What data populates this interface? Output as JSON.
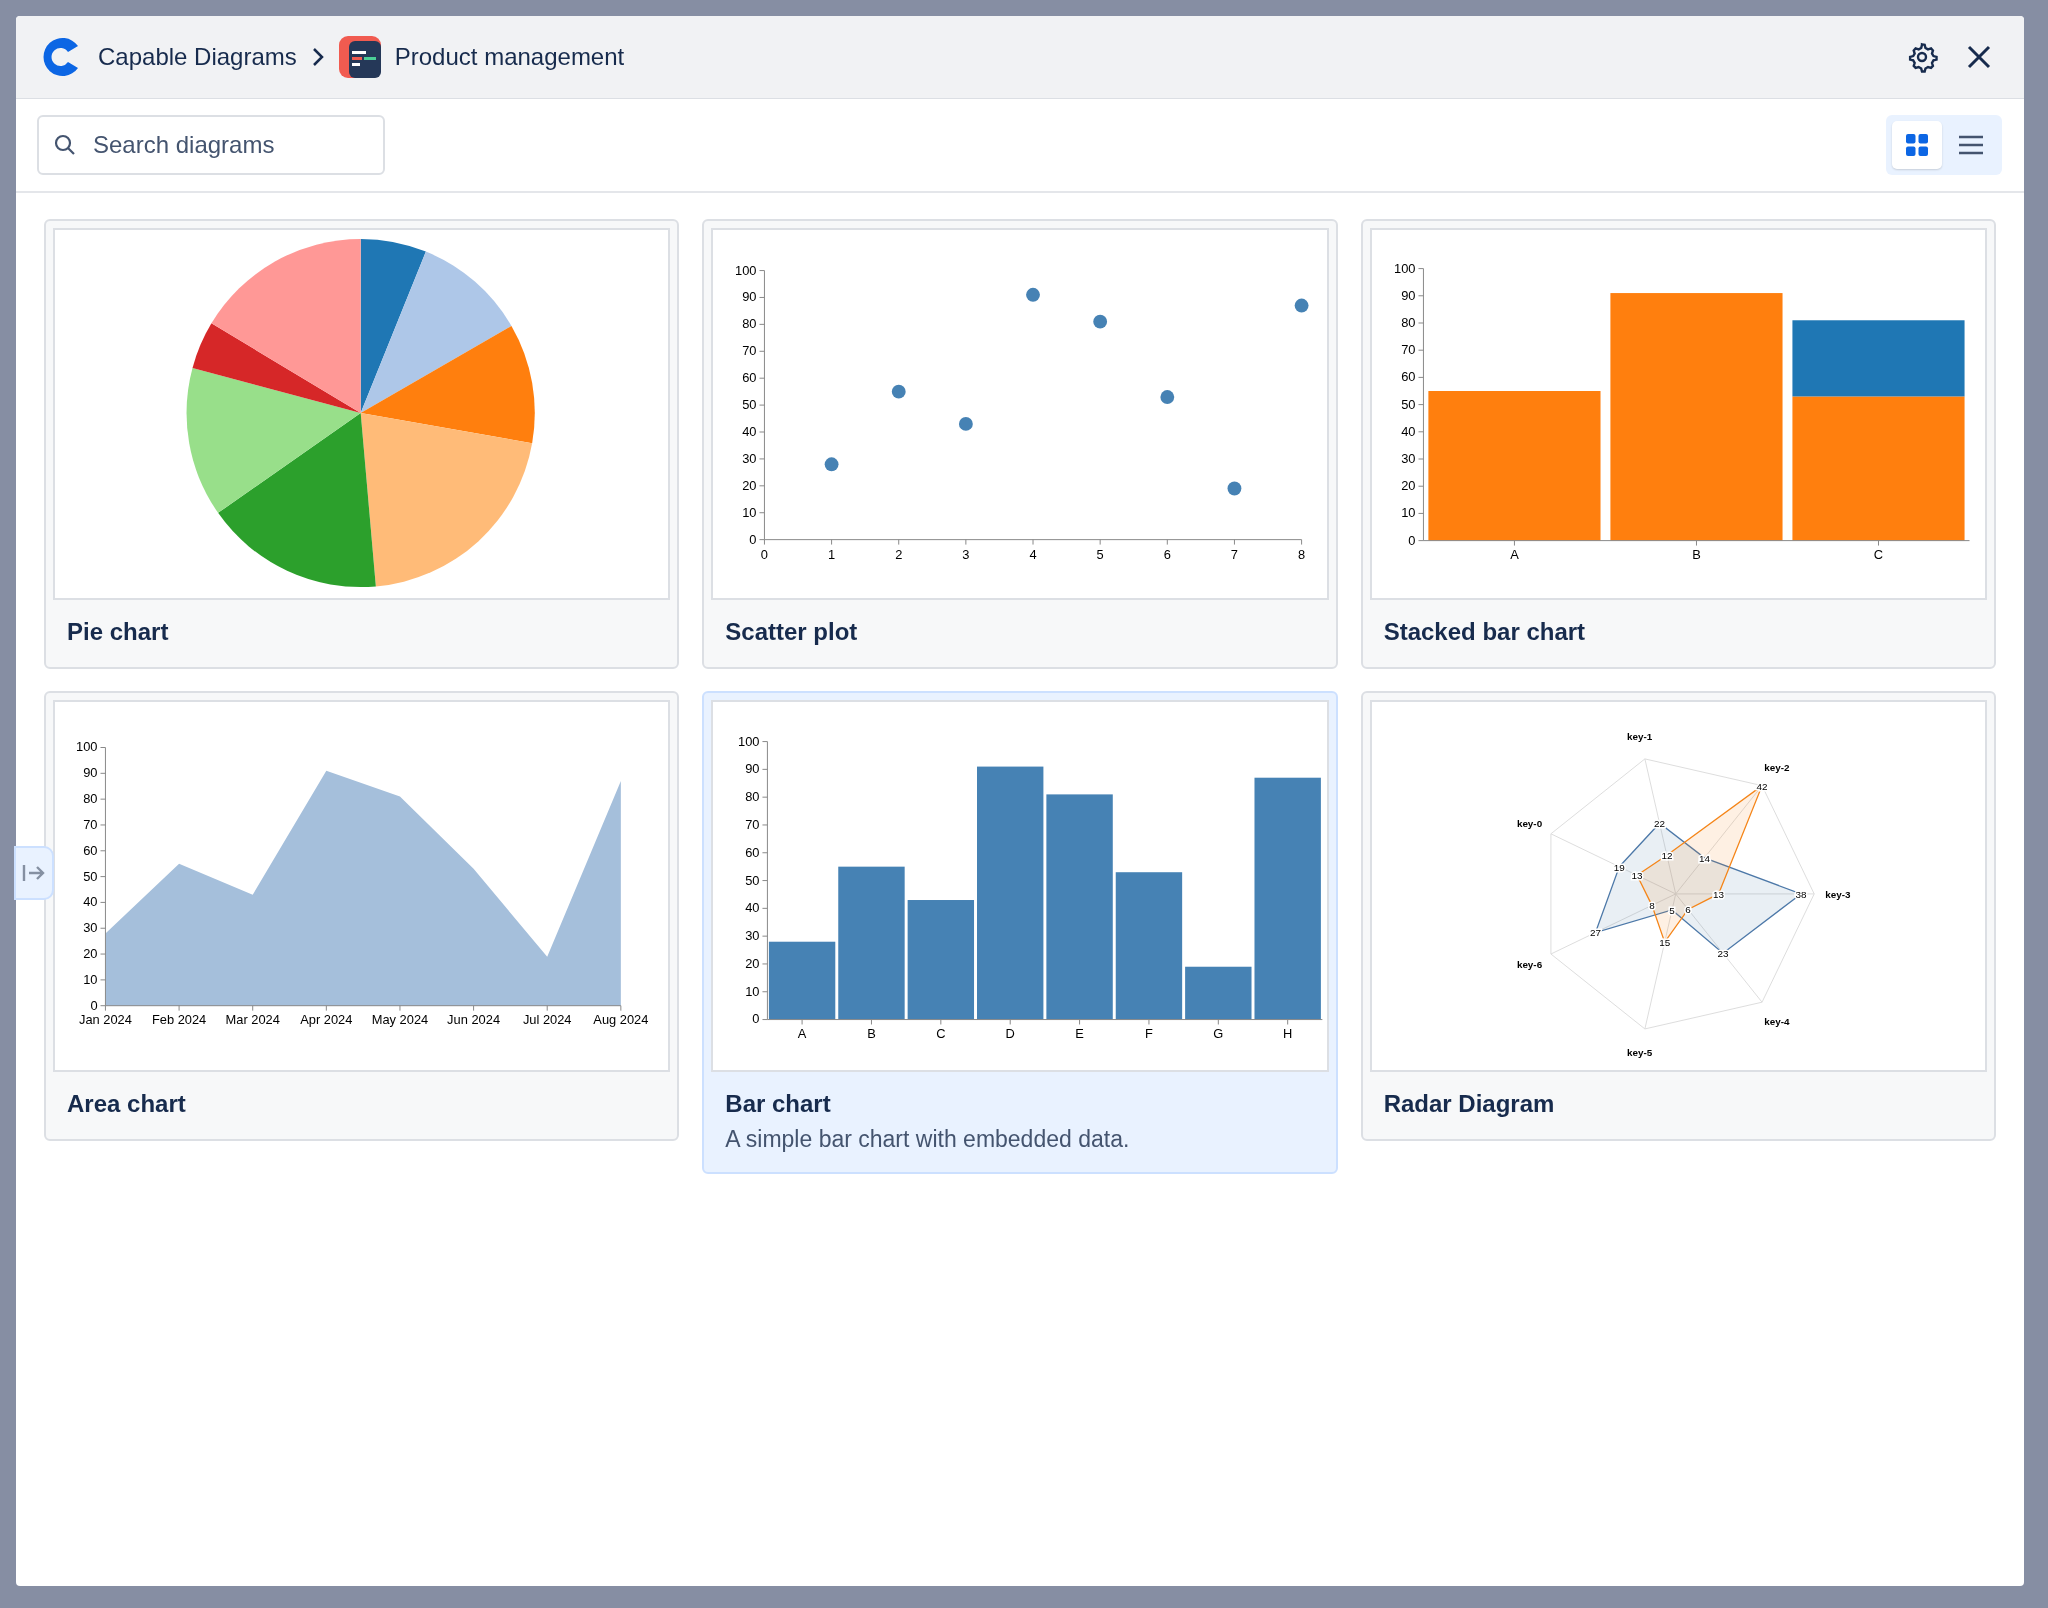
{
  "header": {
    "app_name": "Capable Diagrams",
    "space_title": "Product management"
  },
  "search": {
    "placeholder": "Search diagrams"
  },
  "view_toggle": [
    {
      "kind": "grid",
      "selected": true
    },
    {
      "kind": "list",
      "selected": false
    }
  ],
  "cards": [
    {
      "title": "Pie chart",
      "kind": "pie",
      "selected": false
    },
    {
      "title": "Scatter plot",
      "selected": false,
      "chart_data": {
        "type": "scatter",
        "x": [
          1,
          2,
          3,
          4,
          5,
          6,
          7,
          8
        ],
        "series": [
          {
            "color": "#4682b4",
            "values": [
              28,
              55,
              43,
              91,
              81,
              53,
              19,
              87
            ]
          }
        ],
        "xlim": [
          0,
          8
        ],
        "ylim": [
          0,
          100
        ],
        "xticks": [
          0,
          1,
          2,
          3,
          4,
          5,
          6,
          7,
          8
        ],
        "yticks": [
          0,
          10,
          20,
          30,
          40,
          50,
          60,
          70,
          80,
          90,
          100
        ]
      }
    },
    {
      "title": "Stacked bar chart",
      "selected": false,
      "chart_data": {
        "type": "bar",
        "stacked": true,
        "categories": [
          "A",
          "B",
          "C"
        ],
        "series": [
          {
            "color": "#ff7f0e",
            "values": [
              55,
              91,
              53
            ]
          },
          {
            "color": "#1f77b4",
            "values": [
              0,
              0,
              28
            ]
          }
        ],
        "ylim": [
          0,
          100
        ],
        "yticks": [
          0,
          10,
          20,
          30,
          40,
          50,
          60,
          70,
          80,
          90,
          100
        ]
      }
    },
    {
      "title": "Area chart",
      "selected": false,
      "chart_data": {
        "type": "area",
        "categories": [
          "Jan 2024",
          "Feb 2024",
          "Mar 2024",
          "Apr 2024",
          "May 2024",
          "Jun 2024",
          "Jul 2024",
          "Aug 2024"
        ],
        "series": [
          {
            "color": "#a5bfdb",
            "values": [
              28,
              55,
              43,
              91,
              81,
              53,
              19,
              87
            ]
          }
        ],
        "ylim": [
          0,
          100
        ],
        "yticks": [
          0,
          10,
          20,
          30,
          40,
          50,
          60,
          70,
          80,
          90,
          100
        ]
      }
    },
    {
      "title": "Bar chart",
      "description": "A simple bar chart with embedded data.",
      "selected": true,
      "chart_data": {
        "type": "bar",
        "categories": [
          "A",
          "B",
          "C",
          "D",
          "E",
          "F",
          "G",
          "H"
        ],
        "series": [
          {
            "color": "#4682b4",
            "values": [
              28,
              55,
              43,
              91,
              81,
              53,
              19,
              87
            ]
          }
        ],
        "ylim": [
          0,
          100
        ],
        "yticks": [
          0,
          10,
          20,
          30,
          40,
          50,
          60,
          70,
          80,
          90,
          100
        ]
      }
    },
    {
      "title": "Radar Diagram",
      "kind": "radar",
      "selected": false,
      "radar": {
        "keys": [
          "key-0",
          "key-1",
          "key-2",
          "key-3",
          "key-4",
          "key-5",
          "key-6"
        ],
        "series": [
          {
            "color": "#4c78a8",
            "labels": [
              "19",
              "22",
              "14",
              "38",
              "23",
              "5",
              "27"
            ]
          },
          {
            "color": "#f58518",
            "labels": [
              "13",
              "12",
              "42",
              "13",
              "6",
              "15",
              "8"
            ]
          }
        ]
      }
    }
  ]
}
